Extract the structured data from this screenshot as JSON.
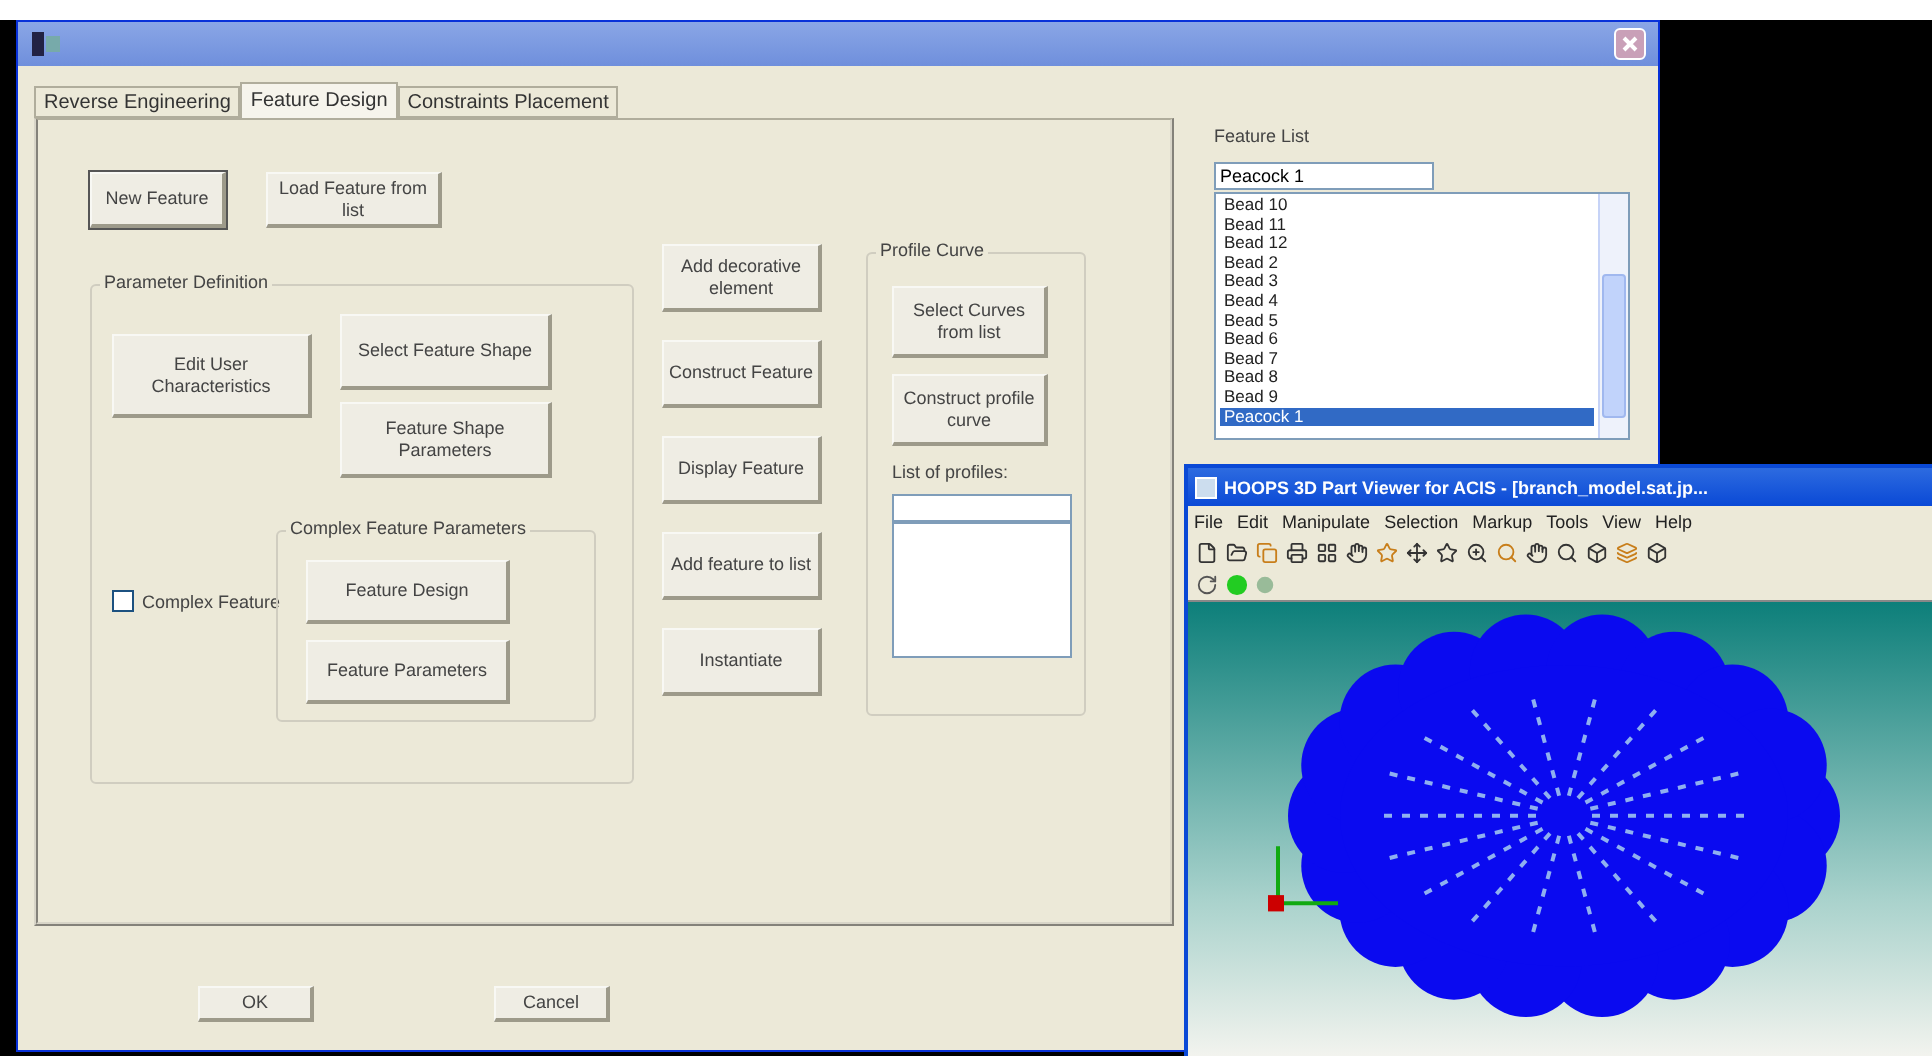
{
  "dialog": {
    "tabs": [
      {
        "label": "Reverse Engineering",
        "selected": false
      },
      {
        "label": "Feature Design",
        "selected": true
      },
      {
        "label": "Constraints Placement",
        "selected": false
      }
    ],
    "top_buttons": [
      {
        "label": "New Feature",
        "default": true
      },
      {
        "label": "Load Feature from list",
        "default": false
      }
    ],
    "parameter_definition": {
      "title": "Parameter Definition",
      "edit_button": "Edit User Characteristics",
      "shape_buttons": [
        "Select Feature Shape",
        "Feature Shape Parameters"
      ],
      "complex_checkbox": {
        "label": "Complex Feature",
        "checked": false
      },
      "complex_group": {
        "title": "Complex Feature Parameters",
        "buttons": [
          "Feature Design",
          "Feature Parameters"
        ]
      }
    },
    "action_buttons": [
      "Add decorative element",
      "Construct Feature",
      "Display Feature",
      "Add feature to list",
      "Instantiate"
    ],
    "profile_curve": {
      "title": "Profile Curve",
      "buttons": [
        "Select Curves from list",
        "Construct profile curve"
      ],
      "list_label": "List of profiles:"
    },
    "feature_list": {
      "label": "Feature List",
      "value": "Peacock 1",
      "items": [
        {
          "label": "Bead 10",
          "selected": false
        },
        {
          "label": "Bead 11",
          "selected": false
        },
        {
          "label": "Bead 12",
          "selected": false
        },
        {
          "label": "Bead 2",
          "selected": false
        },
        {
          "label": "Bead 3",
          "selected": false
        },
        {
          "label": "Bead 4",
          "selected": false
        },
        {
          "label": "Bead 5",
          "selected": false
        },
        {
          "label": "Bead 6",
          "selected": false
        },
        {
          "label": "Bead 7",
          "selected": false
        },
        {
          "label": "Bead 8",
          "selected": false
        },
        {
          "label": "Bead 9",
          "selected": false
        },
        {
          "label": "Peacock 1",
          "selected": true
        }
      ]
    },
    "footer_buttons": [
      "OK",
      "Cancel"
    ]
  },
  "viewer": {
    "title": "HOOPS 3D Part Viewer for ACIS - [branch_model.sat.jp...",
    "menu": [
      "File",
      "Edit",
      "Manipulate",
      "Selection",
      "Markup",
      "Tools",
      "View",
      "Help"
    ]
  }
}
